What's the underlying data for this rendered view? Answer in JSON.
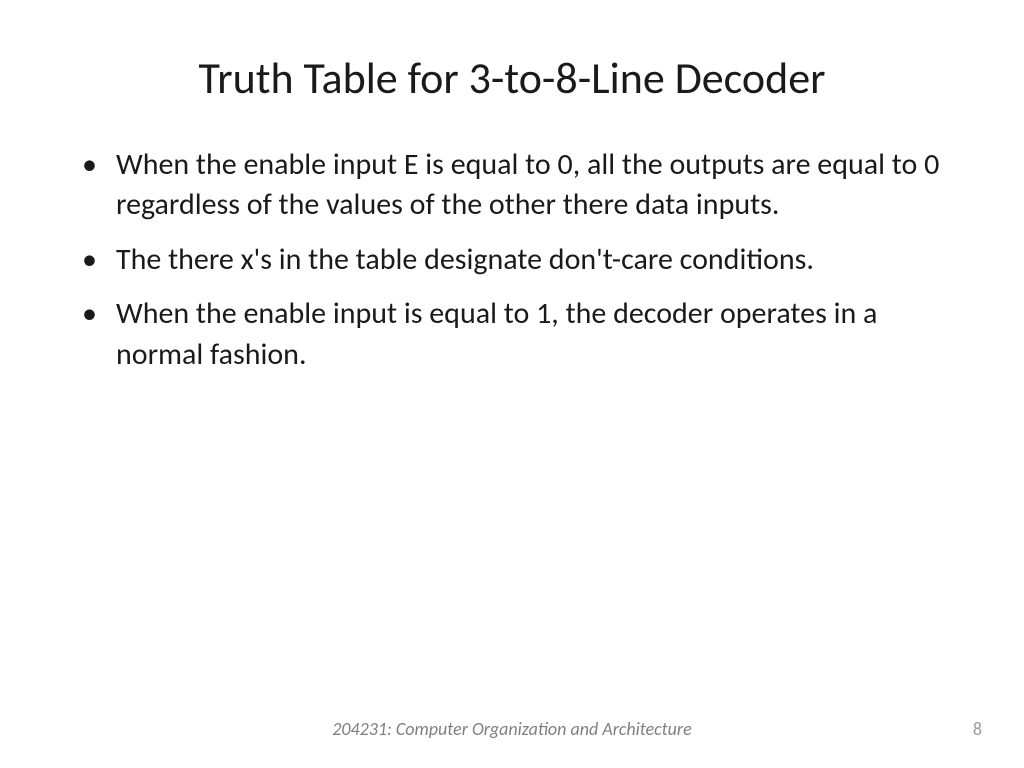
{
  "slide": {
    "title": "Truth Table for 3-to-8-Line Decoder",
    "bullets": [
      "When the enable input E is equal to 0, all the outputs are equal to 0 regardless of the values of the other there data inputs.",
      "The there x's in the table designate don't-care conditions.",
      "When the enable input is equal to 1, the decoder operates in a normal fashion."
    ],
    "footer": "204231: Computer Organization and Architecture",
    "page_number": "8"
  }
}
